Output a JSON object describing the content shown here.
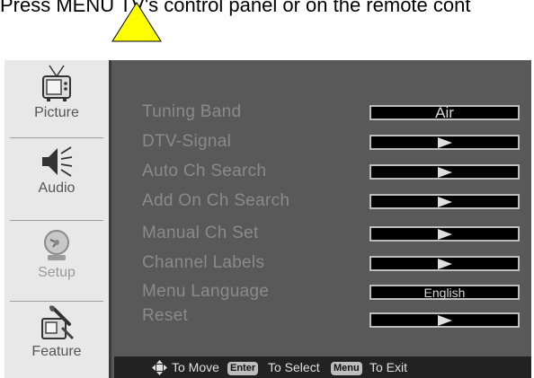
{
  "instruction_text": "Press MENU TV's control panel or on the remote cont",
  "colors": {
    "pointer": "#ffff00",
    "panel": "#595959",
    "sidebar": "#e8e8e8"
  },
  "sidebar": {
    "items": [
      {
        "label": "Picture",
        "icon": "tv-icon"
      },
      {
        "label": "Audio",
        "icon": "speaker-icon"
      },
      {
        "label": "Setup",
        "icon": "satellite-dish-icon"
      },
      {
        "label": "Feature",
        "icon": "tools-icon"
      }
    ]
  },
  "menu": {
    "rows": [
      {
        "label": "Tuning Band",
        "value": "Air"
      },
      {
        "label": "DTV-Signal",
        "value": ""
      },
      {
        "label": "Auto Ch Search",
        "value": ""
      },
      {
        "label": "Add On Ch Search",
        "value": ""
      },
      {
        "label": "Manual Ch Set",
        "value": ""
      },
      {
        "label": "Channel Labels",
        "value": ""
      },
      {
        "label": "Menu Language",
        "value": "English"
      },
      {
        "label": "Reset",
        "value": ""
      }
    ]
  },
  "bottom_bar": {
    "move_label": "To Move",
    "enter_key": "Enter",
    "select_label": "To Select",
    "menu_key": "Menu",
    "exit_label": "To Exit"
  }
}
